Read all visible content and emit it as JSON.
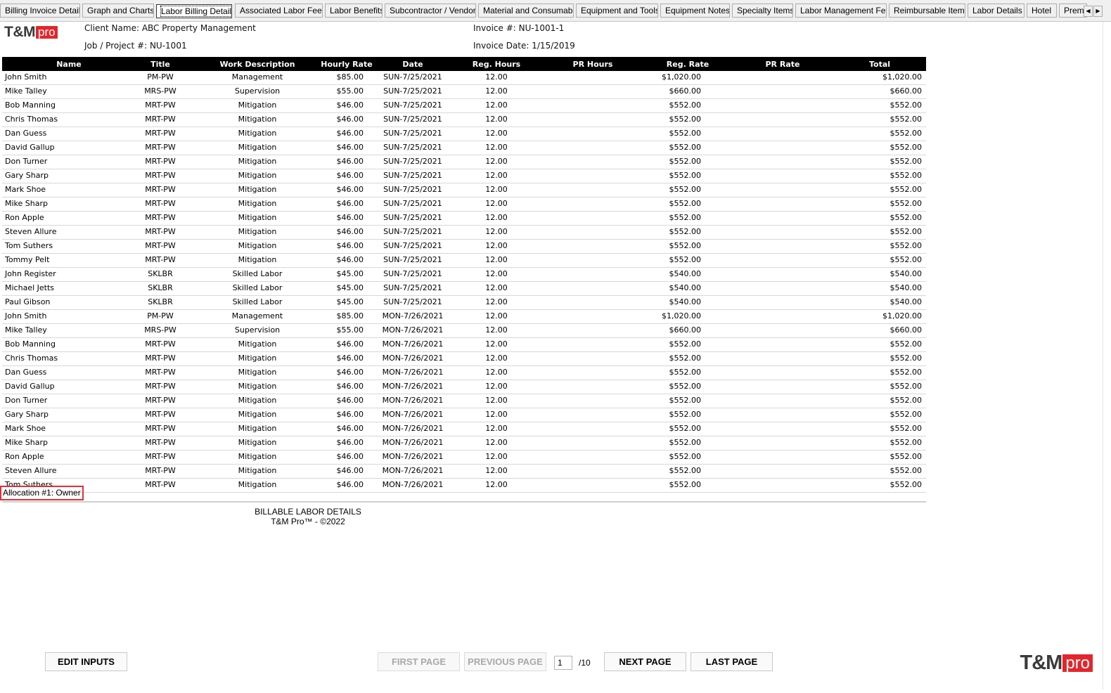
{
  "tabs": [
    {
      "label": "Billing Invoice Details",
      "active": false
    },
    {
      "label": "Graph and Charts",
      "active": false
    },
    {
      "label": "Labor Billing Details",
      "active": true
    },
    {
      "label": "Associated Labor Fees",
      "active": false
    },
    {
      "label": "Labor Benefits",
      "active": false
    },
    {
      "label": "Subcontractor / Vendor",
      "active": false
    },
    {
      "label": "Material and Consumable",
      "active": false
    },
    {
      "label": "Equipment and Tools",
      "active": false
    },
    {
      "label": "Equipment Notes",
      "active": false
    },
    {
      "label": "Specialty Items",
      "active": false
    },
    {
      "label": "Labor Management Fee",
      "active": false
    },
    {
      "label": "Reimbursable Items",
      "active": false
    },
    {
      "label": "Labor Details",
      "active": false
    },
    {
      "label": "Hotel",
      "active": false
    },
    {
      "label": "Prem",
      "active": false
    }
  ],
  "logo": {
    "text": "T&M",
    "badge": "pro"
  },
  "header": {
    "client": "Client Name: ABC Property Management",
    "job": "Job / Project #: NU-1001",
    "invoice_no": "Invoice #: NU-1001-1",
    "invoice_date": "Invoice Date: 1/15/2019"
  },
  "columns": {
    "name": "Name",
    "title": "Title",
    "work": "Work Description",
    "rate": "Hourly Rate",
    "date": "Date",
    "reg_hours": "Reg. Hours",
    "pr_hours": "PR Hours",
    "reg_rate": "Reg. Rate",
    "pr_rate": "PR Rate",
    "total": "Total"
  },
  "rows": [
    [
      "John Smith",
      "PM-PW",
      "Management",
      "$85.00",
      "SUN-7/25/2021",
      "12.00",
      "",
      "$1,020.00",
      "",
      "$1,020.00"
    ],
    [
      "Mike Talley",
      "MRS-PW",
      "Supervision",
      "$55.00",
      "SUN-7/25/2021",
      "12.00",
      "",
      "$660.00",
      "",
      "$660.00"
    ],
    [
      "Bob Manning",
      "MRT-PW",
      "Mitigation",
      "$46.00",
      "SUN-7/25/2021",
      "12.00",
      "",
      "$552.00",
      "",
      "$552.00"
    ],
    [
      "Chris Thomas",
      "MRT-PW",
      "Mitigation",
      "$46.00",
      "SUN-7/25/2021",
      "12.00",
      "",
      "$552.00",
      "",
      "$552.00"
    ],
    [
      "Dan Guess",
      "MRT-PW",
      "Mitigation",
      "$46.00",
      "SUN-7/25/2021",
      "12.00",
      "",
      "$552.00",
      "",
      "$552.00"
    ],
    [
      "David Gallup",
      "MRT-PW",
      "Mitigation",
      "$46.00",
      "SUN-7/25/2021",
      "12.00",
      "",
      "$552.00",
      "",
      "$552.00"
    ],
    [
      "Don Turner",
      "MRT-PW",
      "Mitigation",
      "$46.00",
      "SUN-7/25/2021",
      "12.00",
      "",
      "$552.00",
      "",
      "$552.00"
    ],
    [
      "Gary Sharp",
      "MRT-PW",
      "Mitigation",
      "$46.00",
      "SUN-7/25/2021",
      "12.00",
      "",
      "$552.00",
      "",
      "$552.00"
    ],
    [
      "Mark Shoe",
      "MRT-PW",
      "Mitigation",
      "$46.00",
      "SUN-7/25/2021",
      "12.00",
      "",
      "$552.00",
      "",
      "$552.00"
    ],
    [
      "Mike Sharp",
      "MRT-PW",
      "Mitigation",
      "$46.00",
      "SUN-7/25/2021",
      "12.00",
      "",
      "$552.00",
      "",
      "$552.00"
    ],
    [
      "Ron Apple",
      "MRT-PW",
      "Mitigation",
      "$46.00",
      "SUN-7/25/2021",
      "12.00",
      "",
      "$552.00",
      "",
      "$552.00"
    ],
    [
      "Steven Allure",
      "MRT-PW",
      "Mitigation",
      "$46.00",
      "SUN-7/25/2021",
      "12.00",
      "",
      "$552.00",
      "",
      "$552.00"
    ],
    [
      "Tom Suthers",
      "MRT-PW",
      "Mitigation",
      "$46.00",
      "SUN-7/25/2021",
      "12.00",
      "",
      "$552.00",
      "",
      "$552.00"
    ],
    [
      "Tommy Pelt",
      "MRT-PW",
      "Mitigation",
      "$46.00",
      "SUN-7/25/2021",
      "12.00",
      "",
      "$552.00",
      "",
      "$552.00"
    ],
    [
      "John Register",
      "SKLBR",
      "Skilled Labor",
      "$45.00",
      "SUN-7/25/2021",
      "12.00",
      "",
      "$540.00",
      "",
      "$540.00"
    ],
    [
      "Michael Jetts",
      "SKLBR",
      "Skilled Labor",
      "$45.00",
      "SUN-7/25/2021",
      "12.00",
      "",
      "$540.00",
      "",
      "$540.00"
    ],
    [
      "Paul Gibson",
      "SKLBR",
      "Skilled Labor",
      "$45.00",
      "SUN-7/25/2021",
      "12.00",
      "",
      "$540.00",
      "",
      "$540.00"
    ],
    [
      "John Smith",
      "PM-PW",
      "Management",
      "$85.00",
      "MON-7/26/2021",
      "12.00",
      "",
      "$1,020.00",
      "",
      "$1,020.00"
    ],
    [
      "Mike Talley",
      "MRS-PW",
      "Supervision",
      "$55.00",
      "MON-7/26/2021",
      "12.00",
      "",
      "$660.00",
      "",
      "$660.00"
    ],
    [
      "Bob Manning",
      "MRT-PW",
      "Mitigation",
      "$46.00",
      "MON-7/26/2021",
      "12.00",
      "",
      "$552.00",
      "",
      "$552.00"
    ],
    [
      "Chris Thomas",
      "MRT-PW",
      "Mitigation",
      "$46.00",
      "MON-7/26/2021",
      "12.00",
      "",
      "$552.00",
      "",
      "$552.00"
    ],
    [
      "Dan Guess",
      "MRT-PW",
      "Mitigation",
      "$46.00",
      "MON-7/26/2021",
      "12.00",
      "",
      "$552.00",
      "",
      "$552.00"
    ],
    [
      "David Gallup",
      "MRT-PW",
      "Mitigation",
      "$46.00",
      "MON-7/26/2021",
      "12.00",
      "",
      "$552.00",
      "",
      "$552.00"
    ],
    [
      "Don Turner",
      "MRT-PW",
      "Mitigation",
      "$46.00",
      "MON-7/26/2021",
      "12.00",
      "",
      "$552.00",
      "",
      "$552.00"
    ],
    [
      "Gary Sharp",
      "MRT-PW",
      "Mitigation",
      "$46.00",
      "MON-7/26/2021",
      "12.00",
      "",
      "$552.00",
      "",
      "$552.00"
    ],
    [
      "Mark Shoe",
      "MRT-PW",
      "Mitigation",
      "$46.00",
      "MON-7/26/2021",
      "12.00",
      "",
      "$552.00",
      "",
      "$552.00"
    ],
    [
      "Mike Sharp",
      "MRT-PW",
      "Mitigation",
      "$46.00",
      "MON-7/26/2021",
      "12.00",
      "",
      "$552.00",
      "",
      "$552.00"
    ],
    [
      "Ron Apple",
      "MRT-PW",
      "Mitigation",
      "$46.00",
      "MON-7/26/2021",
      "12.00",
      "",
      "$552.00",
      "",
      "$552.00"
    ],
    [
      "Steven Allure",
      "MRT-PW",
      "Mitigation",
      "$46.00",
      "MON-7/26/2021",
      "12.00",
      "",
      "$552.00",
      "",
      "$552.00"
    ],
    [
      "Tom Suthers",
      "MRT-PW",
      "Mitigation",
      "$46.00",
      "MON-7/26/2021",
      "12.00",
      "",
      "$552.00",
      "",
      "$552.00"
    ]
  ],
  "allocation": "Allocation #1: Owner",
  "footer": {
    "line1": "BILLABLE LABOR DETAILS",
    "line2": "T&M Pro™ - ©2022"
  },
  "buttons": {
    "edit_inputs": "EDIT INPUTS",
    "first_page": "FIRST PAGE",
    "previous_page": "PREVIOUS PAGE",
    "next_page": "NEXT PAGE",
    "last_page": "LAST PAGE"
  },
  "pagination": {
    "current": "1",
    "total": "/10"
  },
  "colors": {
    "brand_red": "#e3262b",
    "header_black": "#000000",
    "highlight_red": "#e0303a"
  }
}
